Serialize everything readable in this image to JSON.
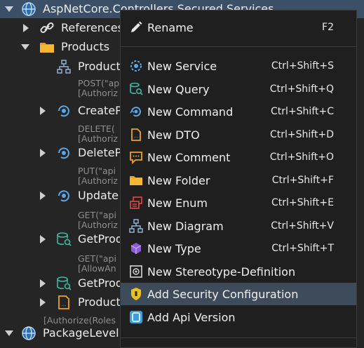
{
  "tree": {
    "root_label": "AspNetCore.Controllers.Secured.Services",
    "references_label": "References",
    "products_label": "Products",
    "items": [
      {
        "label": "Product",
        "anno": ""
      },
      {
        "label": "CreateP",
        "anno": "POST(\"ap\n[Authoriz"
      },
      {
        "label": "DeleteP",
        "anno": "DELETE(\n[Authoriz"
      },
      {
        "label": "Update",
        "anno": "PUT(\"api\n[Authoriz"
      },
      {
        "label": "GetProd",
        "anno": "GET(\"api\n[Authoriz"
      },
      {
        "label": "GetProd",
        "anno": "GET(\"api\n[AllowAn"
      },
      {
        "label": "Product",
        "anno": ""
      }
    ],
    "bottom_anno": "[Authorize(Roles",
    "package_label": "PackageLevel"
  },
  "menu": {
    "rename": {
      "label": "Rename",
      "shortcut": "F2"
    },
    "items": [
      {
        "label": "New Service",
        "shortcut": "Ctrl+Shift+S",
        "icon": "service-icon"
      },
      {
        "label": "New Query",
        "shortcut": "Ctrl+Shift+Q",
        "icon": "query-icon"
      },
      {
        "label": "New Command",
        "shortcut": "Ctrl+Shift+C",
        "icon": "command-icon"
      },
      {
        "label": "New DTO",
        "shortcut": "Ctrl+Shift+D",
        "icon": "dto-icon"
      },
      {
        "label": "New Comment",
        "shortcut": "Ctrl+Shift+O",
        "icon": "comment-icon"
      },
      {
        "label": "New Folder",
        "shortcut": "Ctrl+Shift+F",
        "icon": "folder-icon"
      },
      {
        "label": "New Enum",
        "shortcut": "Ctrl+Shift+E",
        "icon": "enum-icon"
      },
      {
        "label": "New Diagram",
        "shortcut": "Ctrl+Shift+V",
        "icon": "diagram-icon"
      },
      {
        "label": "New Type",
        "shortcut": "Ctrl+Shift+T",
        "icon": "type-icon"
      },
      {
        "label": "New Stereotype-Definition",
        "shortcut": "",
        "icon": "stereotype-icon"
      },
      {
        "label": "Add Security Configuration",
        "shortcut": "",
        "icon": "shield-icon"
      },
      {
        "label": "Add Api Version",
        "shortcut": "",
        "icon": "api-version-icon"
      }
    ]
  },
  "colors": {
    "background": "#252526",
    "menu_bg": "#1f1f1f",
    "highlight": "#3e4b5b",
    "accent": "#3ba0e0"
  }
}
